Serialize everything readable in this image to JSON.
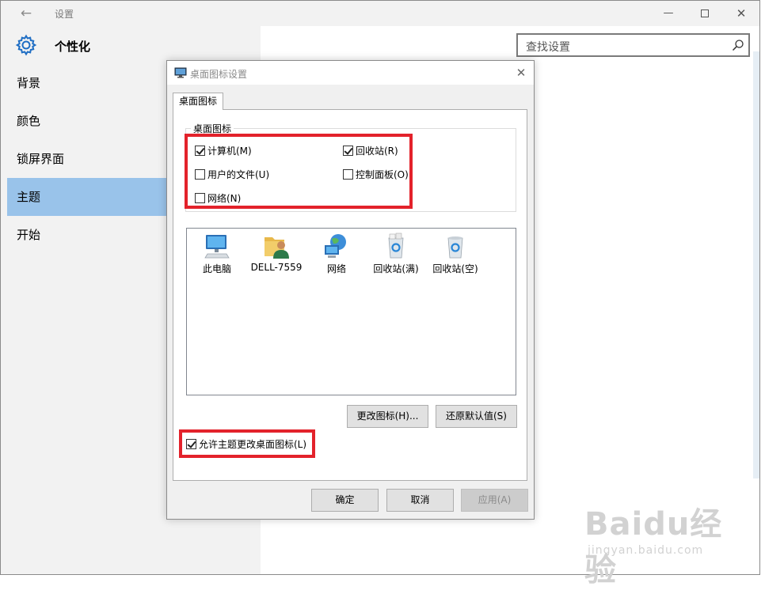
{
  "window": {
    "back_glyph": "←",
    "title": "设置",
    "minimize_glyph": "—",
    "close_glyph": "✕"
  },
  "sidebar": {
    "section_title": "个性化",
    "items": [
      {
        "label": "背景",
        "selected": false
      },
      {
        "label": "颜色",
        "selected": false
      },
      {
        "label": "锁屏界面",
        "selected": false
      },
      {
        "label": "主题",
        "selected": true
      },
      {
        "label": "开始",
        "selected": false
      }
    ]
  },
  "search": {
    "placeholder": "查找设置"
  },
  "dialog": {
    "title": "桌面图标设置",
    "close_glyph": "✕",
    "tab_label": "桌面图标",
    "group_label": "桌面图标",
    "checkboxes": {
      "computer": {
        "label": "计算机(M)",
        "checked": true
      },
      "recycle": {
        "label": "回收站(R)",
        "checked": true
      },
      "user_files": {
        "label": "用户的文件(U)",
        "checked": false
      },
      "control_panel": {
        "label": "控制面板(O)",
        "checked": false
      },
      "network": {
        "label": "网络(N)",
        "checked": false
      }
    },
    "icons": [
      {
        "label": "此电脑"
      },
      {
        "label": "DELL-7559"
      },
      {
        "label": "网络"
      },
      {
        "label": "回收站(满)"
      },
      {
        "label": "回收站(空)"
      }
    ],
    "change_icon_button": "更改图标(H)...",
    "restore_default_button": "还原默认值(S)",
    "allow_theme": {
      "label": "允许主题更改桌面图标(L)",
      "checked": true
    },
    "ok_button": "确定",
    "cancel_button": "取消",
    "apply_button": "应用(A)"
  },
  "watermark": {
    "logo": "Baidu经验",
    "url": "jingyan.baidu.com"
  },
  "colors": {
    "selected_nav": "#99c3ea",
    "highlight_red": "#e3222b",
    "sidebar_bg": "#f2f2f2",
    "dialog_bg": "#f0f0f0"
  }
}
